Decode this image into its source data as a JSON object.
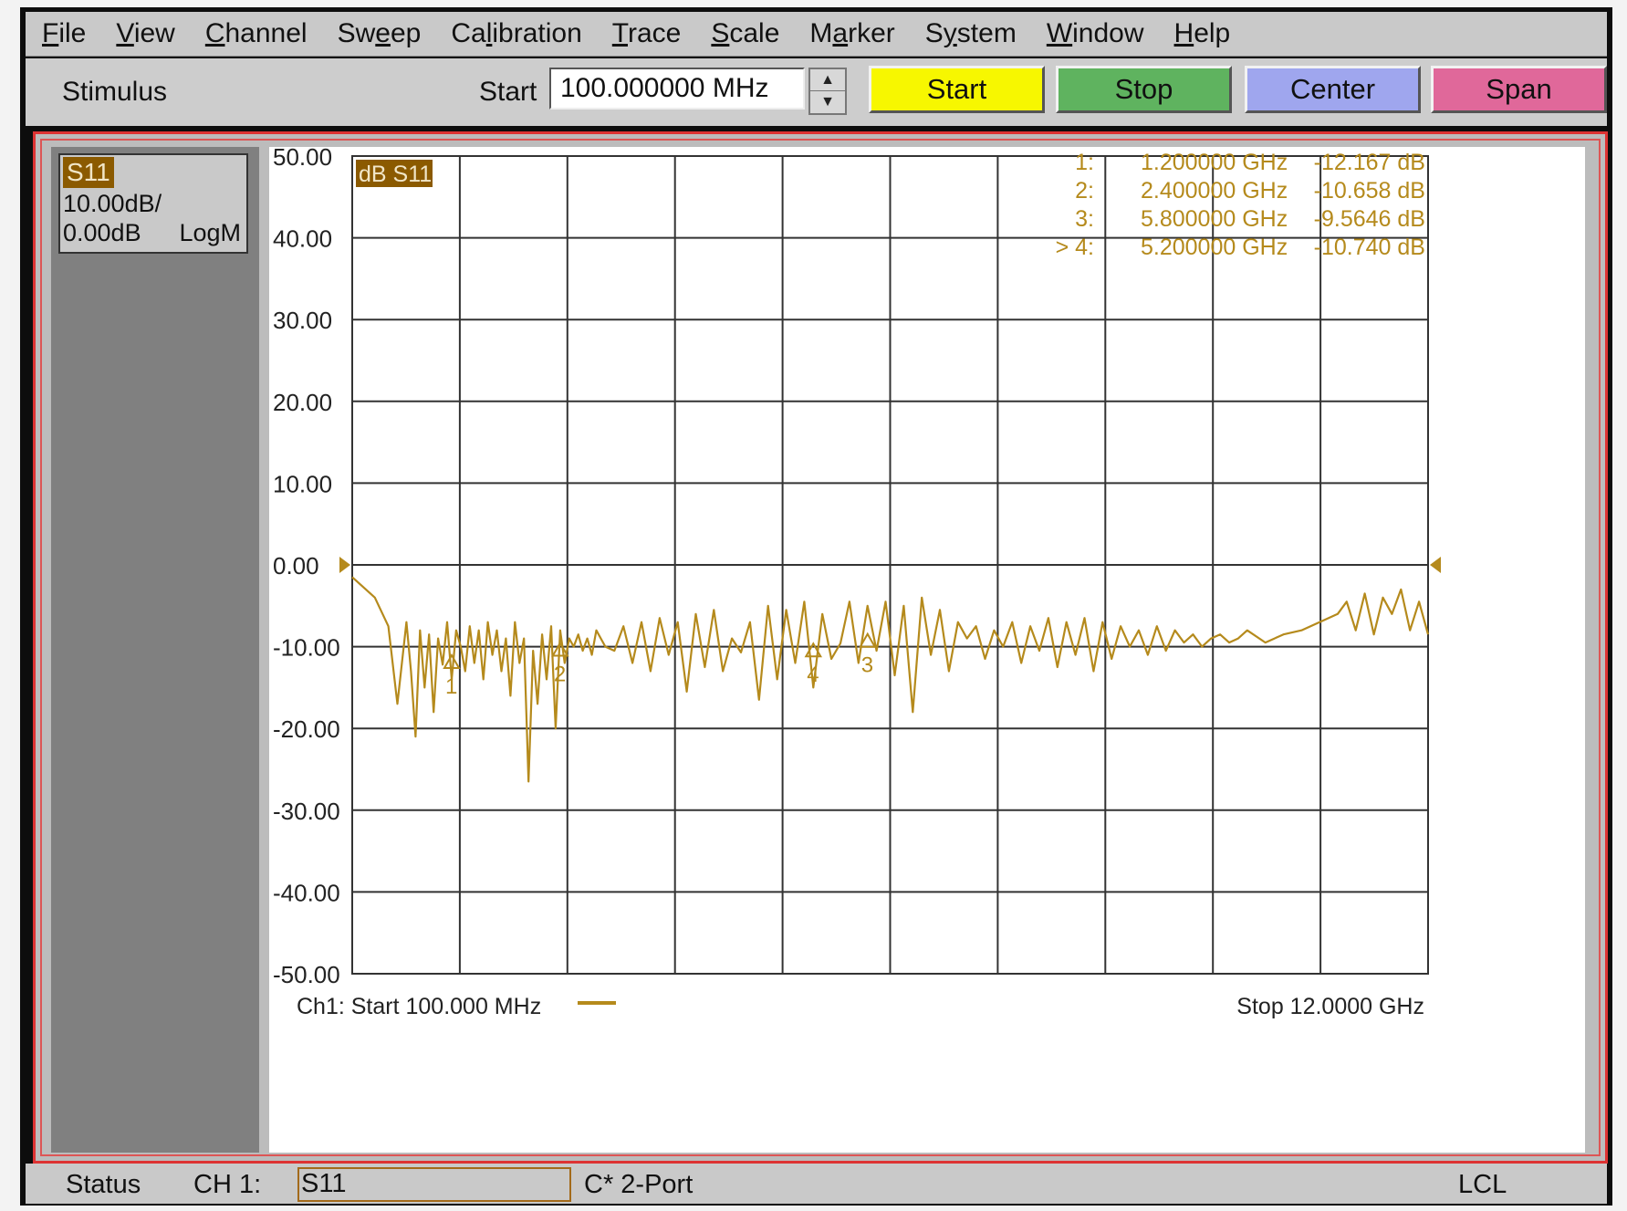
{
  "menu": [
    "File",
    "View",
    "Channel",
    "Sweep",
    "Calibration",
    "Trace",
    "Scale",
    "Marker",
    "System",
    "Window",
    "Help"
  ],
  "menu_access_keys": [
    "F",
    "V",
    "C",
    "e",
    "l",
    "T",
    "S",
    "a",
    "y",
    "W",
    "H"
  ],
  "toolbar": {
    "stimulus_label": "Stimulus",
    "start_field_label": "Start",
    "start_value": "100.000000 MHz",
    "buttons": [
      {
        "id": "start",
        "label": "Start",
        "color": "#f7f700"
      },
      {
        "id": "stop",
        "label": "Stop",
        "color": "#5fb35f"
      },
      {
        "id": "center",
        "label": "Center",
        "color": "#9fa6ee"
      },
      {
        "id": "span",
        "label": "Span",
        "color": "#e0689a"
      }
    ]
  },
  "trace_panel": {
    "name": "S11",
    "scale": "10.00dB/",
    "ref": "0.00dB",
    "format": "LogM"
  },
  "plot": {
    "trace_label": "dB S11",
    "trace_color": "#b58a1c",
    "footer_start": "Ch1: Start  100.000 MHz",
    "footer_stop": "Stop  12.0000 GHz",
    "markers_readout": [
      {
        "id": "1:",
        "freq": "1.200000 GHz",
        "value": "-12.167 dB",
        "active": false
      },
      {
        "id": "2:",
        "freq": "2.400000 GHz",
        "value": "-10.658 dB",
        "active": false
      },
      {
        "id": "3:",
        "freq": "5.800000 GHz",
        "value": "-9.5646 dB",
        "active": false
      },
      {
        "id": "> 4:",
        "freq": "5.200000 GHz",
        "value": "-10.740 dB",
        "active": true
      }
    ]
  },
  "chart_data": {
    "type": "line",
    "xlim": [
      0.1,
      12.0
    ],
    "x_unit": "GHz",
    "ylim": [
      -50,
      50
    ],
    "yticks": [
      "50.00",
      "40.00",
      "30.00",
      "20.00",
      "10.00",
      "0.00",
      "-10.00",
      "-20.00",
      "-30.00",
      "-40.00",
      "-50.00"
    ],
    "reference_level": 0,
    "grid": true,
    "series": [
      {
        "name": "S11",
        "x": [
          0.1,
          0.35,
          0.5,
          0.6,
          0.7,
          0.75,
          0.8,
          0.85,
          0.9,
          0.95,
          1.0,
          1.05,
          1.1,
          1.15,
          1.2,
          1.25,
          1.3,
          1.35,
          1.4,
          1.45,
          1.5,
          1.55,
          1.6,
          1.65,
          1.7,
          1.75,
          1.8,
          1.85,
          1.9,
          1.95,
          2.0,
          2.05,
          2.1,
          2.15,
          2.2,
          2.25,
          2.3,
          2.35,
          2.4,
          2.45,
          2.5,
          2.55,
          2.6,
          2.65,
          2.7,
          2.75,
          2.8,
          2.9,
          3.0,
          3.1,
          3.2,
          3.3,
          3.4,
          3.5,
          3.6,
          3.7,
          3.8,
          3.9,
          4.0,
          4.1,
          4.2,
          4.3,
          4.4,
          4.5,
          4.6,
          4.7,
          4.8,
          4.9,
          5.0,
          5.1,
          5.2,
          5.3,
          5.4,
          5.5,
          5.6,
          5.7,
          5.8,
          5.9,
          6.0,
          6.1,
          6.2,
          6.3,
          6.4,
          6.5,
          6.6,
          6.7,
          6.8,
          6.9,
          7.0,
          7.1,
          7.2,
          7.3,
          7.4,
          7.5,
          7.6,
          7.7,
          7.8,
          7.9,
          8.0,
          8.1,
          8.2,
          8.3,
          8.4,
          8.5,
          8.6,
          8.7,
          8.8,
          8.9,
          9.0,
          9.1,
          9.2,
          9.3,
          9.4,
          9.5,
          9.6,
          9.7,
          9.8,
          9.9,
          10.0,
          10.2,
          10.4,
          10.6,
          10.8,
          11.0,
          11.1,
          11.2,
          11.3,
          11.4,
          11.5,
          11.6,
          11.7,
          11.8,
          11.9,
          12.0
        ],
        "y": [
          -1.5,
          -4.0,
          -7.5,
          -17.0,
          -7.0,
          -13.0,
          -21.0,
          -8.0,
          -15.0,
          -8.5,
          -18.0,
          -9.0,
          -12.2,
          -7.0,
          -14.0,
          -8.0,
          -10.0,
          -13.0,
          -7.5,
          -12.0,
          -8.0,
          -14.0,
          -7.0,
          -11.0,
          -8.0,
          -13.0,
          -9.0,
          -16.0,
          -7.0,
          -12.0,
          -9.0,
          -26.5,
          -10.5,
          -17.0,
          -8.5,
          -14.0,
          -7.5,
          -20.0,
          -8.0,
          -12.0,
          -9.0,
          -10.0,
          -8.5,
          -10.5,
          -9.0,
          -11.0,
          -8.0,
          -10.0,
          -10.5,
          -7.5,
          -12.0,
          -7.0,
          -13.0,
          -6.5,
          -11.0,
          -7.0,
          -15.5,
          -6.0,
          -12.5,
          -5.5,
          -13.0,
          -9.0,
          -10.7,
          -7.0,
          -16.5,
          -5.0,
          -14.0,
          -5.5,
          -12.0,
          -4.5,
          -15.0,
          -6.0,
          -11.5,
          -9.6,
          -4.5,
          -12.0,
          -5.0,
          -10.5,
          -4.5,
          -13.5,
          -5.0,
          -18.0,
          -4.0,
          -11.0,
          -5.5,
          -13.0,
          -7.0,
          -9.0,
          -7.5,
          -11.5,
          -8.0,
          -10.0,
          -7.0,
          -12.0,
          -7.5,
          -10.5,
          -6.5,
          -12.5,
          -7.0,
          -11.0,
          -6.5,
          -13.0,
          -7.0,
          -11.5,
          -7.5,
          -10.0,
          -8.0,
          -11.0,
          -7.5,
          -10.5,
          -8.0,
          -9.5,
          -8.5,
          -10.0,
          -9.0,
          -8.5,
          -9.5,
          -9.0,
          -8.0,
          -9.5,
          -8.5,
          -8.0,
          -7.0,
          -6.0,
          -4.5,
          -8.0,
          -3.5,
          -8.5,
          -4.0,
          -6.0,
          -3.0,
          -8.0,
          -4.5,
          -8.5
        ]
      }
    ],
    "markers": [
      {
        "label": "1",
        "x": 1.2,
        "y": -12.167
      },
      {
        "label": "2",
        "x": 2.4,
        "y": -10.658
      },
      {
        "label": "3",
        "x": 5.8,
        "y": -9.5646
      },
      {
        "label": "4",
        "x": 5.2,
        "y": -10.74
      }
    ]
  },
  "statusbar": {
    "status_label": "Status",
    "channel_label": "CH 1:",
    "measurement": "S11",
    "cal_state": "C* 2-Port",
    "remote_state": "LCL"
  }
}
